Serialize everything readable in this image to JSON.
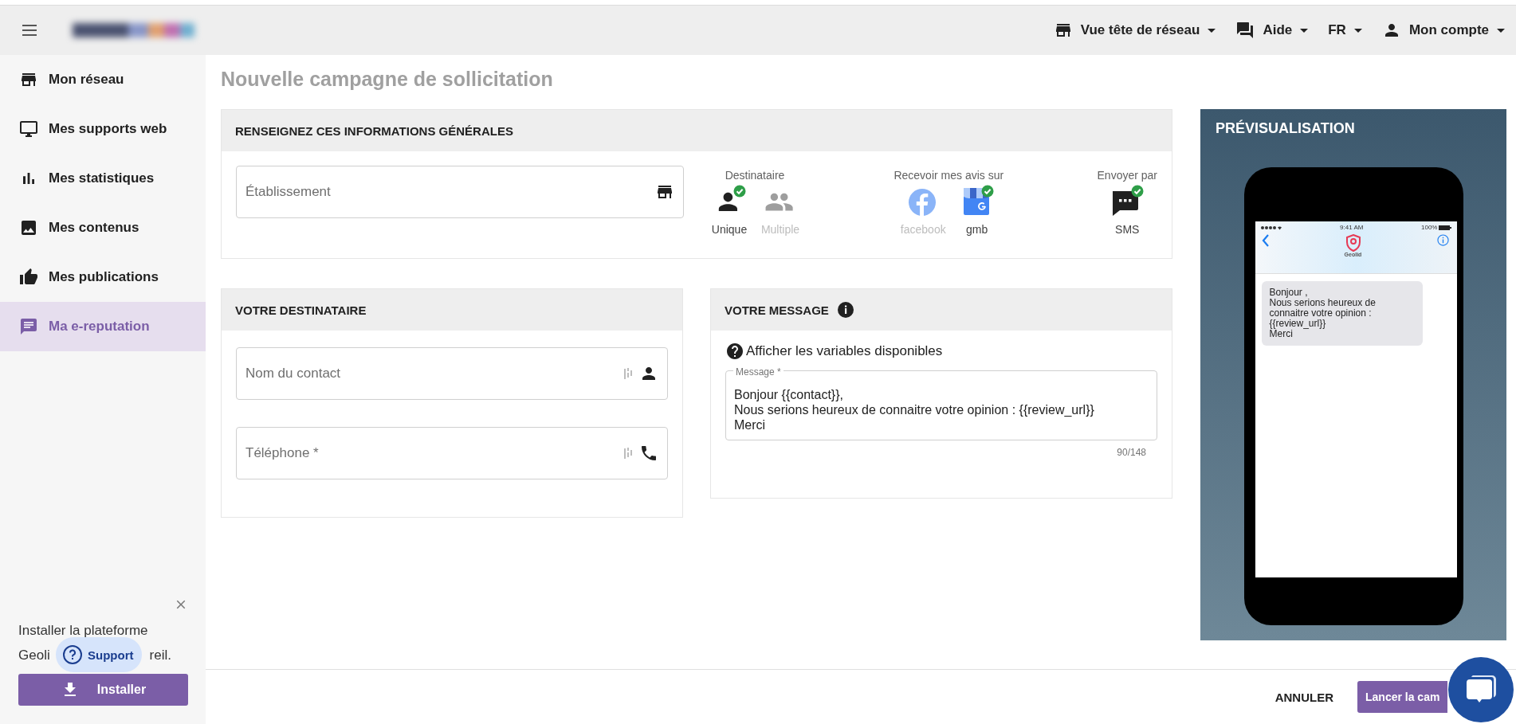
{
  "topbar": {
    "items": [
      {
        "kind": "store",
        "label": "Vue tête de réseau"
      },
      {
        "kind": "forum",
        "label": "Aide"
      },
      {
        "kind": "none",
        "label": "FR"
      },
      {
        "kind": "person",
        "label": "Mon compte"
      }
    ]
  },
  "sidebar": {
    "items": [
      {
        "label": "Mon réseau",
        "selected": false
      },
      {
        "label": "Mes supports web",
        "selected": false
      },
      {
        "label": "Mes statistiques",
        "selected": false
      },
      {
        "label": "Mes contenus",
        "selected": false
      },
      {
        "label": "Mes publications",
        "selected": false
      },
      {
        "label": "Ma e-reputation",
        "selected": true
      }
    ]
  },
  "install_banner": {
    "text": [
      "Installer la plateforme",
      "Geoli",
      "reil."
    ],
    "button": "Installer"
  },
  "support_button": "Support",
  "title": "Nouvelle campagne de sollicitation",
  "general": {
    "heading": "RENSEIGNEZ CES INFORMATIONS GÉNÉRALES",
    "establishment": {
      "placeholder": "Établissement"
    },
    "groups": [
      {
        "label": "Destinataire",
        "options": [
          {
            "kind": "person",
            "label": "Unique",
            "selected": true
          },
          {
            "kind": "people",
            "label": "Multiple",
            "selected": false
          }
        ]
      },
      {
        "label": "Recevoir mes avis sur",
        "options": [
          {
            "kind": "facebook",
            "label": "facebook",
            "selected": false
          },
          {
            "kind": "gmb",
            "label": "gmb",
            "selected": true
          }
        ]
      },
      {
        "label": "Envoyer par",
        "options": [
          {
            "kind": "sms",
            "label": "SMS",
            "selected": true
          }
        ]
      }
    ]
  },
  "recipient": {
    "heading": "VOTRE DESTINATAIRE",
    "fields": [
      {
        "kind": "person",
        "placeholder": "Nom du contact"
      },
      {
        "kind": "phone",
        "placeholder": "Téléphone *"
      }
    ]
  },
  "message": {
    "heading": "VOTRE MESSAGE",
    "help": "Afficher les variables disponibles",
    "field": {
      "label": "Message *",
      "lines": [
        "Bonjour {{contact}},",
        "Nous serions heureux de connaitre votre opinion : {{review_url}}",
        "Merci"
      ]
    },
    "counter": "90/148"
  },
  "preview": {
    "heading": "PRÉVISUALISATION",
    "time": "9:41 AM",
    "battery": "100%",
    "sender": "Geolid",
    "bubble": [
      "Bonjour ,",
      "Nous serions heureux de",
      "connaitre votre opinion :",
      "{{review_url}}",
      "Merci"
    ]
  },
  "footer": {
    "cancel": "ANNULER",
    "submit": "Lancer la cam"
  }
}
